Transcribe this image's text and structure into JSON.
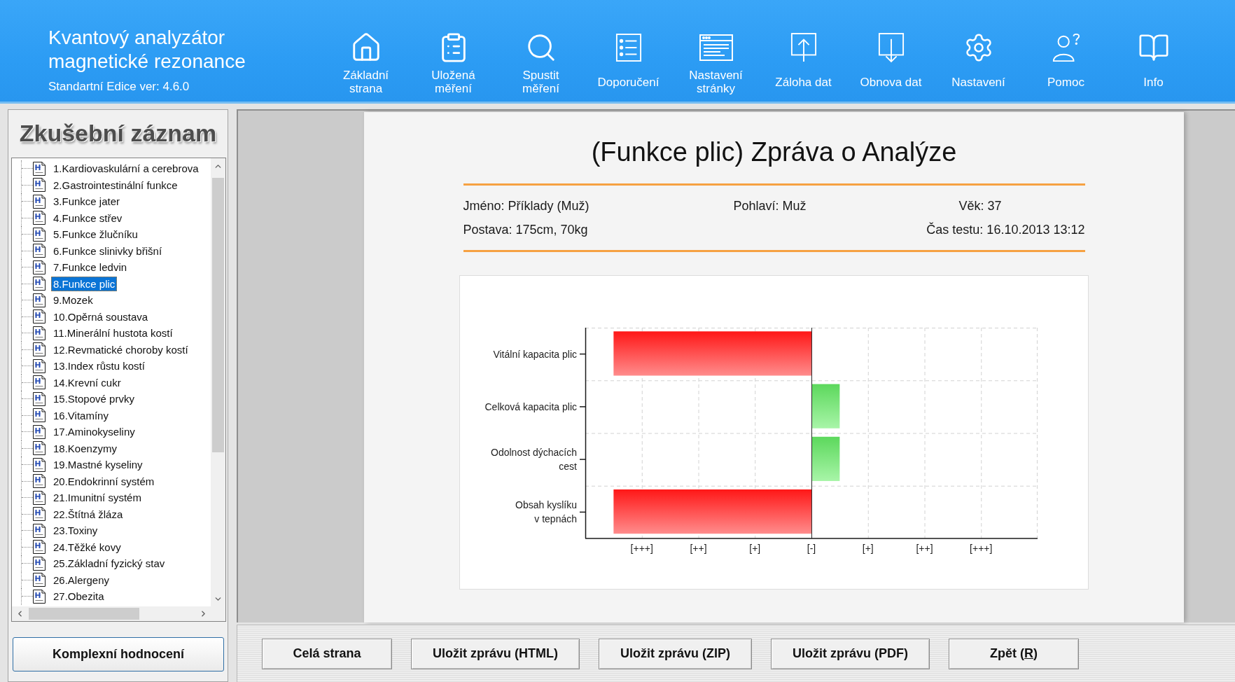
{
  "header": {
    "title": "Kvantový analyzátor magnetické rezonance",
    "edition": "Standartní Edice ver: 4.6.0"
  },
  "nav": [
    {
      "label": "Základní strana"
    },
    {
      "label": "Uložená měření"
    },
    {
      "label": "Spustit měření"
    },
    {
      "label": "Doporučení"
    },
    {
      "label": "Nastavení stránky"
    },
    {
      "label": "Záloha dat"
    },
    {
      "label": "Obnova dat"
    },
    {
      "label": "Nastavení"
    },
    {
      "label": "Pomoc"
    },
    {
      "label": "Info"
    }
  ],
  "sidebar": {
    "title": "Zkušební záznam",
    "records": [
      {
        "label": "1.Kardiovaskulární a cerebrova",
        "selected": false
      },
      {
        "label": "2.Gastrointestinální funkce",
        "selected": false
      },
      {
        "label": "3.Funkce jater",
        "selected": false
      },
      {
        "label": "4.Funkce střev",
        "selected": false
      },
      {
        "label": "5.Funkce žlučníku",
        "selected": false
      },
      {
        "label": "6.Funkce slinivky břišní",
        "selected": false
      },
      {
        "label": "7.Funkce ledvin",
        "selected": false
      },
      {
        "label": "8.Funkce plic",
        "selected": true
      },
      {
        "label": "9.Mozek",
        "selected": false
      },
      {
        "label": "10.Opěrná soustava",
        "selected": false
      },
      {
        "label": "11.Minerální hustota kostí",
        "selected": false
      },
      {
        "label": "12.Revmatické choroby kostí",
        "selected": false
      },
      {
        "label": "13.Index růstu kostí",
        "selected": false
      },
      {
        "label": "14.Krevní cukr",
        "selected": false
      },
      {
        "label": "15.Stopové prvky",
        "selected": false
      },
      {
        "label": "16.Vitamíny",
        "selected": false
      },
      {
        "label": "17.Aminokyseliny",
        "selected": false
      },
      {
        "label": "18.Koenzymy",
        "selected": false
      },
      {
        "label": "19.Mastné kyseliny",
        "selected": false
      },
      {
        "label": "20.Endokrinní systém",
        "selected": false
      },
      {
        "label": "21.Imunitní systém",
        "selected": false
      },
      {
        "label": "22.Štítná žláza",
        "selected": false
      },
      {
        "label": "23.Toxiny",
        "selected": false
      },
      {
        "label": "24.Těžké kovy",
        "selected": false
      },
      {
        "label": "25.Základní fyzický stav",
        "selected": false
      },
      {
        "label": "26.Alergeny",
        "selected": false
      },
      {
        "label": "27.Obezita",
        "selected": false
      }
    ],
    "button": "Komplexní hodnocení"
  },
  "report": {
    "title": "(Funkce plic) Zpráva o Analýze",
    "name": "Jméno: Příklady (Muž)",
    "sex": "Pohlaví: Muž",
    "age": "Věk: 37",
    "build": "Postava: 175cm, 70kg",
    "test_time": "Čas testu: 16.10.2013 13:12",
    "chart": {
      "rows": [
        "Vitální kapacita plic",
        "Celková kapacita plic",
        "Odolnost dýchacích\ncest",
        "Obsah kyslíku\nv tepnách"
      ],
      "scale_labels": [
        "[+++]",
        "[++]",
        "[+]",
        "[-]",
        "[+]",
        "[++]",
        "[+++]"
      ]
    }
  },
  "buttons": [
    {
      "label": "Celá strana"
    },
    {
      "label": "Uložit zprávu (HTML)"
    },
    {
      "label": "Uložit zprávu (ZIP)"
    },
    {
      "label": "Uložit zprávu (PDF)"
    },
    {
      "label": "Zpět (",
      "accelerator": "R",
      "label_end": ")"
    }
  ]
}
